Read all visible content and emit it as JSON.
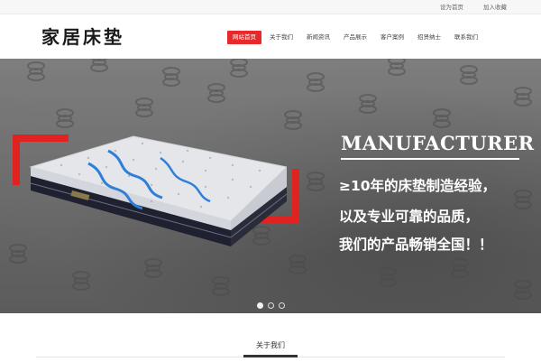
{
  "topbar": {
    "links": [
      "设为首页",
      "加入收藏"
    ]
  },
  "header": {
    "logo_text": "家居床垫",
    "nav": [
      {
        "label": "网站首页",
        "active": true
      },
      {
        "label": "关于我们",
        "active": false
      },
      {
        "label": "新闻资讯",
        "active": false
      },
      {
        "label": "产品展示",
        "active": false
      },
      {
        "label": "客户案例",
        "active": false
      },
      {
        "label": "招贤纳士",
        "active": false
      },
      {
        "label": "联系我们",
        "active": false
      }
    ]
  },
  "banner": {
    "headline": "MANUFACTURER",
    "taglines": [
      "≥10年的床垫制造经验，",
      "以及专业可靠的品质，",
      "我们的产品畅销全国！！"
    ],
    "slide_count": 3,
    "active_slide": 1,
    "accent_color": "#e02320"
  },
  "section": {
    "title": "关于我们"
  },
  "colors": {
    "nav_active": "#e8292b"
  }
}
